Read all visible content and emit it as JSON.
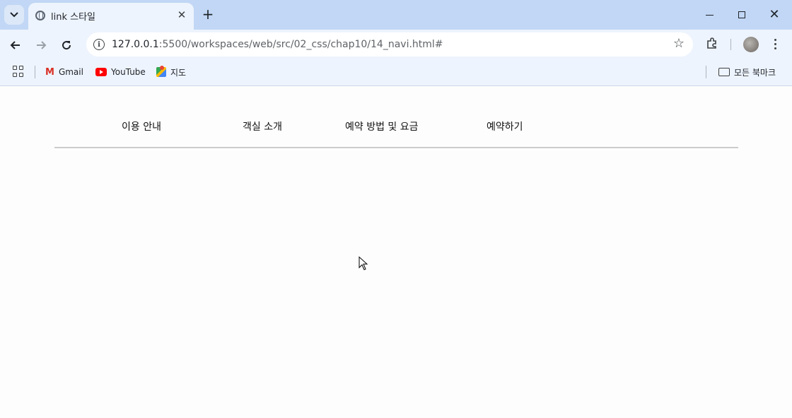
{
  "tab": {
    "title": "link 스타일"
  },
  "omnibox": {
    "url_host": "127.0.0.1",
    "url_rest": ":5500/workspaces/web/src/02_css/chap10/14_navi.html#"
  },
  "bookmarks": {
    "items": [
      {
        "label": "Gmail"
      },
      {
        "label": "YouTube"
      },
      {
        "label": "지도"
      }
    ],
    "all_bookmarks": "모든 북마크"
  },
  "nav": {
    "items": [
      {
        "label": "이용 안내"
      },
      {
        "label": "객실 소개"
      },
      {
        "label": "예약 방법 및 요금"
      },
      {
        "label": "예약하기"
      }
    ]
  },
  "icons": {
    "tab_search": "chevron-down-icon",
    "tab_favicon": "globe-icon",
    "star": "star-icon",
    "extensions": "puzzle-icon",
    "menu": "more-vert-icon"
  },
  "colors": {
    "tabstrip": "#c1d7f5",
    "toolbar": "#eef4fd",
    "nav_underline": "#cccccc"
  }
}
